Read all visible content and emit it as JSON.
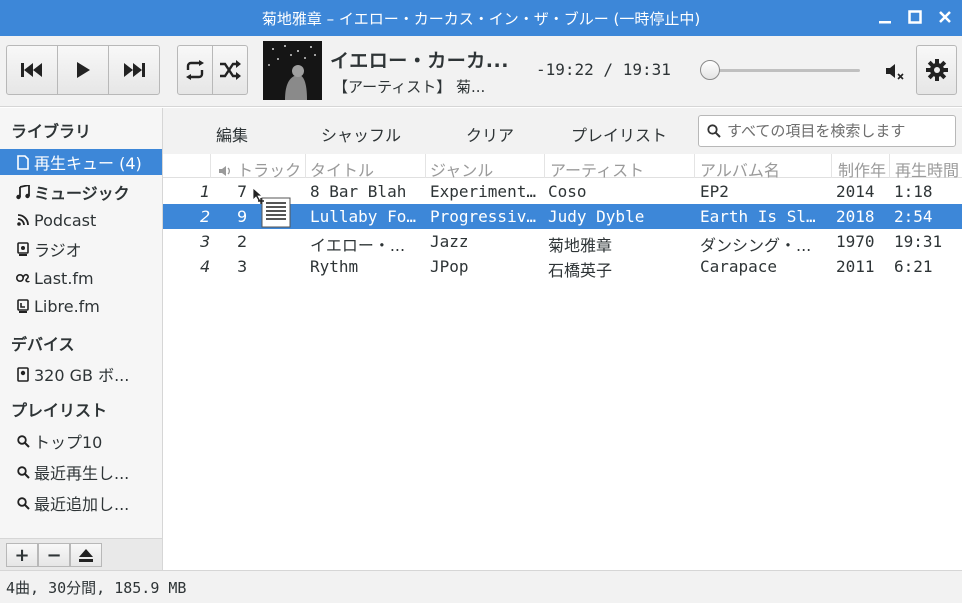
{
  "window": {
    "title": "菊地雅章 – イエロー・カーカス・イン・ザ・ブルー (一時停止中)"
  },
  "player": {
    "track_title": "イエロー・カーカ...",
    "track_artist": "【アーティスト】 菊...",
    "time": "-19:22 / 19:31",
    "seek_fraction": 0.0
  },
  "sidebar": {
    "library_heading": "ライブラリ",
    "library_items": [
      {
        "label": "再生キュー (4)",
        "icon": "document-icon"
      },
      {
        "label": "ミュージック",
        "icon": "music-note-icon"
      },
      {
        "label": "Podcast",
        "icon": "rss-icon"
      },
      {
        "label": "ラジオ",
        "icon": "radio-icon"
      },
      {
        "label": "Last.fm",
        "icon": "lastfm-icon"
      },
      {
        "label": "Libre.fm",
        "icon": "librefm-icon"
      }
    ],
    "devices_heading": "デバイス",
    "device_items": [
      {
        "label": "320 GB ボ...",
        "icon": "drive-icon"
      }
    ],
    "playlists_heading": "プレイリスト",
    "playlist_items": [
      {
        "label": "トップ10",
        "icon": "search-icon"
      },
      {
        "label": "最近再生し...",
        "icon": "search-icon"
      },
      {
        "label": "最近追加し...",
        "icon": "search-icon"
      }
    ],
    "add_label": "+",
    "remove_label": "−"
  },
  "content_toolbar": {
    "edit": "編集",
    "shuffle": "シャッフル",
    "clear": "クリア",
    "playlist": "プレイリスト"
  },
  "search": {
    "placeholder": "すべての項目を検索します"
  },
  "table": {
    "headers": [
      "トラック",
      "タイトル",
      "ジャンル",
      "アーティスト",
      "アルバム名",
      "制作年",
      "再生時間"
    ],
    "rows": [
      {
        "index": "1",
        "track": "7",
        "title": "8 Bar Blah",
        "genre": "Experiment…",
        "artist": "Coso",
        "album": "EP2",
        "year": "2014",
        "duration": "1:18"
      },
      {
        "index": "2",
        "track": "9",
        "title": "Lullaby Fo…",
        "genre": "Progressiv…",
        "artist": "Judy Dyble",
        "album": "Earth Is Sl…",
        "year": "2018",
        "duration": "2:54"
      },
      {
        "index": "3",
        "track": "2",
        "title": "イエロー・...",
        "genre": "Jazz",
        "artist": "菊地雅章",
        "album": "ダンシング・...",
        "year": "1970",
        "duration": "19:31"
      },
      {
        "index": "4",
        "track": "3",
        "title": "Rythm",
        "genre": "JPop",
        "artist": "石橋英子",
        "album": "Carapace",
        "year": "2011",
        "duration": "6:21"
      }
    ]
  },
  "status": {
    "text": "4曲, 30分間, 185.9 MB"
  },
  "colors": {
    "accent": "#3d87d8",
    "toolbar_bg": "#f2f2f2"
  }
}
